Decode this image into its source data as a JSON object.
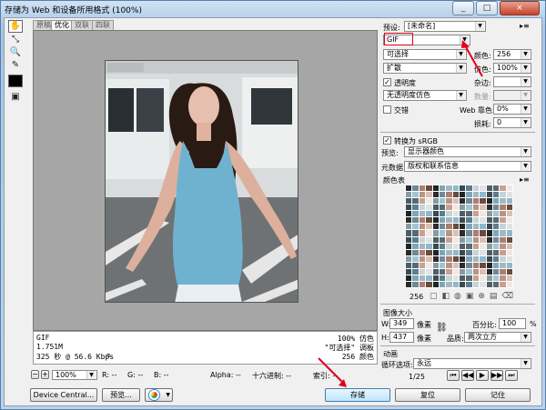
{
  "window": {
    "title": "存储为 Web 和设备所用格式 (100%)",
    "controls": [
      "_",
      "□",
      "×"
    ]
  },
  "tabs": [
    "原稿",
    "优化",
    "双联",
    "四联"
  ],
  "tools": [
    "hand-tool",
    "slice-select-tool",
    "zoom-tool",
    "eyedropper-tool",
    "eyedropper-color",
    "toggle-slices"
  ],
  "info": {
    "format": "GIF",
    "size": "1.751M",
    "time": "325 秒 @ 56.6 Kbps",
    "dither_pct": "100% 仿色",
    "palette": "\"可选择\" 调板",
    "colors": "256 颜色"
  },
  "status": {
    "zoom": "100%",
    "r": "R: --",
    "g": "G: --",
    "b": "B: --",
    "alpha": "Alpha: --",
    "hex": "十六进制: --",
    "index": "索引: --"
  },
  "buttons": {
    "device_central": "Device Central...",
    "preview": "预览...",
    "save": "存储",
    "reset": "复位",
    "remember": "记住"
  },
  "settings": {
    "preset_label": "预设:",
    "preset_value": "[未命名]",
    "format": "GIF",
    "reduction": "可选择",
    "colors_label": "颜色:",
    "colors_value": "256",
    "dither_algo": "扩散",
    "dither_label": "仿色:",
    "dither_value": "100%",
    "transparency_label": "透明度",
    "transparency_checked": true,
    "matte_label": "杂边:",
    "matte_value": "",
    "trans_dither": "无透明度仿色",
    "amount_label": "数量:",
    "amount_value": "",
    "interlaced_label": "交错",
    "interlaced_checked": false,
    "web_snap_label": "Web 靠色:",
    "web_snap_value": "0%",
    "lossy_label": "损耗:",
    "lossy_value": "0",
    "convert_srgb_label": "转换为 sRGB",
    "convert_srgb_checked": true,
    "preview_label": "预览:",
    "preview_value": "显示器颜色",
    "metadata_label": "元数据:",
    "metadata_value": "版权和联系信息"
  },
  "color_table": {
    "title": "颜色表",
    "count": "256"
  },
  "image_size": {
    "title": "图像大小",
    "w_label": "W:",
    "w_value": "349",
    "h_label": "H:",
    "h_value": "437",
    "unit": "像素",
    "percent_label": "百分比:",
    "percent_value": "100",
    "percent_unit": "%",
    "quality_label": "品质:",
    "quality_value": "两次立方"
  },
  "animation": {
    "title": "动画",
    "loop_label": "循环选项:",
    "loop_value": "永远",
    "frame": "1/25"
  },
  "colors": {
    "highlight": "#e0001b",
    "accent": "#3c7fb1"
  }
}
